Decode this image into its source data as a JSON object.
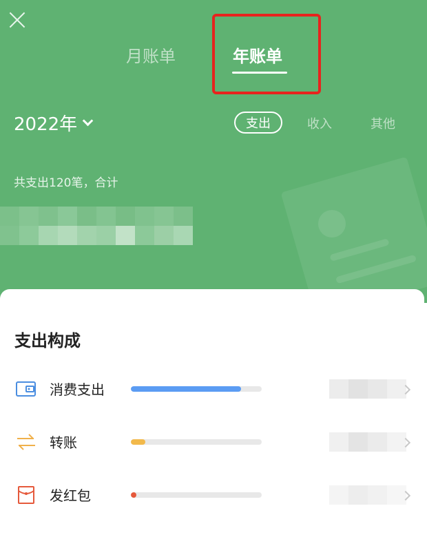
{
  "header": {
    "tabs": [
      {
        "label": "月账单",
        "active": false
      },
      {
        "label": "年账单",
        "active": true
      }
    ],
    "year_label": "2022年",
    "filters": [
      {
        "label": "支出",
        "active": true
      },
      {
        "label": "收入",
        "active": false
      },
      {
        "label": "其他",
        "active": false
      }
    ],
    "summary": "共支出120笔，合计"
  },
  "composition": {
    "title": "支出构成",
    "items": [
      {
        "label": "消费支出",
        "icon": "wallet-icon",
        "fraction": 0.84,
        "color": "#5b9cf3"
      },
      {
        "label": "转账",
        "icon": "transfer-icon",
        "fraction": 0.11,
        "color": "#f2b94b"
      },
      {
        "label": "发红包",
        "icon": "red-packet-icon",
        "fraction": 0.04,
        "color": "#e5593b"
      }
    ]
  },
  "colors": {
    "header_bg": "#5fb272",
    "highlight": "#e8231d"
  }
}
